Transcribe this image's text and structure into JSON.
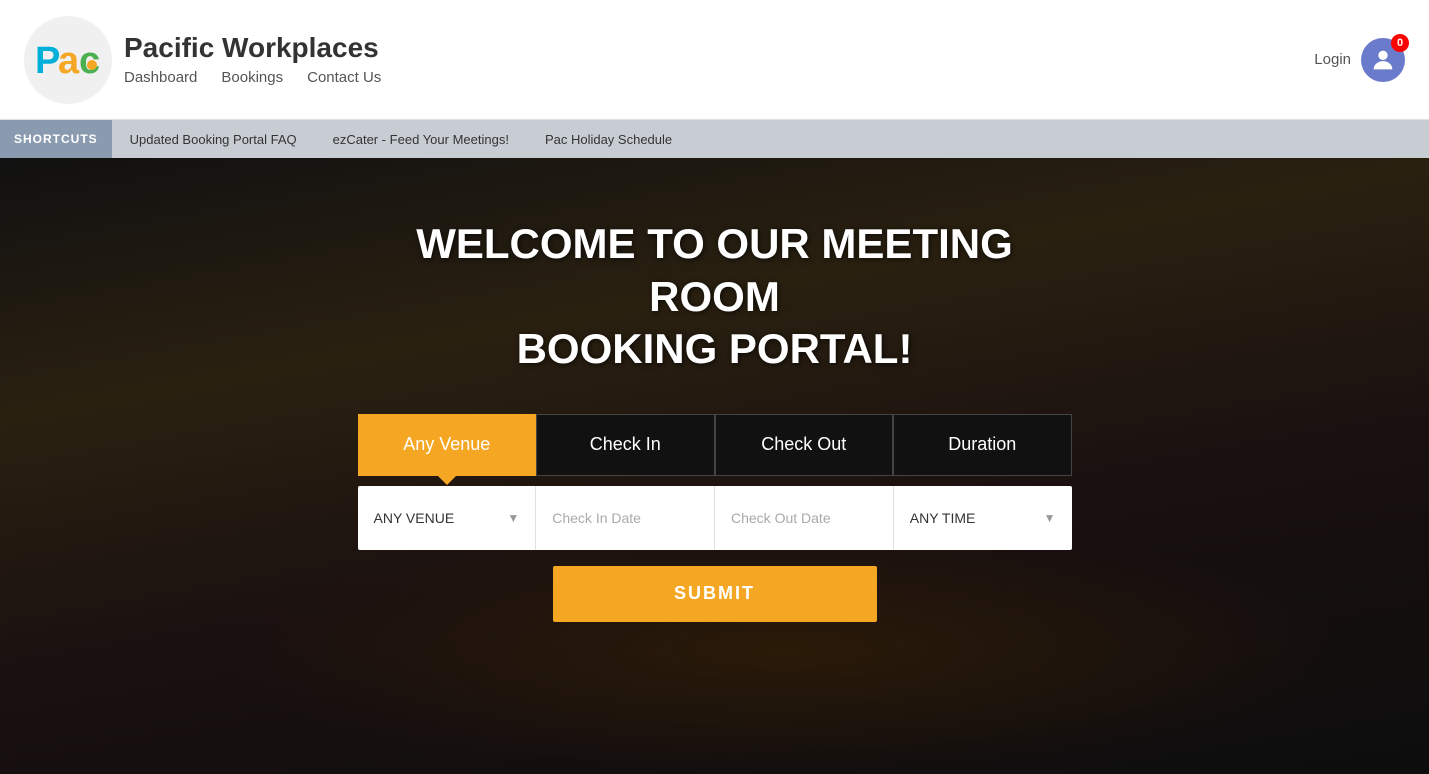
{
  "header": {
    "brand_name": "Pacific Workplaces",
    "nav": {
      "dashboard": "Dashboard",
      "bookings": "Bookings",
      "contact": "Contact Us"
    },
    "login_label": "Login",
    "badge_count": "0"
  },
  "shortcuts": {
    "label": "SHORTCUTS",
    "items": [
      "Updated Booking Portal FAQ",
      "ezCater - Feed Your Meetings!",
      "Pac Holiday Schedule"
    ]
  },
  "hero": {
    "title_line1": "WELCOME TO OUR MEETING ROOM",
    "title_line2": "BOOKING PORTAL!"
  },
  "booking": {
    "tabs": [
      {
        "id": "any-venue",
        "label": "Any Venue",
        "active": true
      },
      {
        "id": "check-in",
        "label": "Check In",
        "active": false
      },
      {
        "id": "check-out",
        "label": "Check Out",
        "active": false
      },
      {
        "id": "duration",
        "label": "Duration",
        "active": false
      }
    ],
    "venue_select": {
      "value": "ANY VENUE",
      "placeholder": "ANY VENUE"
    },
    "check_in_placeholder": "Check In Date",
    "check_out_placeholder": "Check Out Date",
    "time_select": {
      "value": "ANY TIME",
      "placeholder": "ANY TIME"
    },
    "submit_label": "SUBMIT"
  }
}
